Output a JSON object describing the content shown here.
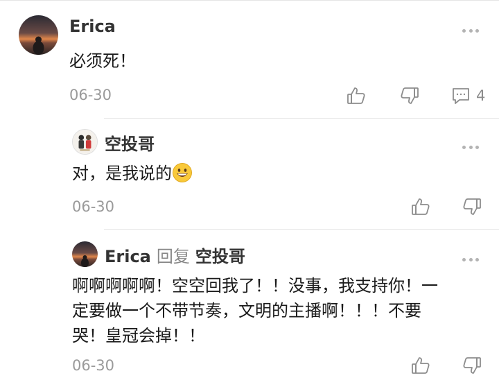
{
  "comments": [
    {
      "author": "Erica",
      "text": "必须死！",
      "date": "06-30",
      "reply_count": "4"
    },
    {
      "author": "空投哥",
      "text": "对，是我说的",
      "emoji": "grinning-face-emoji",
      "date": "06-30"
    },
    {
      "author": "Erica",
      "reply_label": "回复",
      "reply_to": "空投哥",
      "text_lines": [
        "啊啊啊啊啊！空空回我了！！没事，我支持你！一",
        "定要做一个不带节奏，文明的主播啊！！！不要",
        "哭！皇冠会掉！！"
      ],
      "date": "06-30"
    }
  ],
  "colors": {
    "text": "#1a1a1a",
    "name": "#333333",
    "muted": "#9a9a9a",
    "icon": "#8c8c8c",
    "divider": "#e5e5e5"
  },
  "icons": [
    "thumb-up-icon",
    "thumb-down-icon",
    "comment-icon",
    "more-icon"
  ]
}
